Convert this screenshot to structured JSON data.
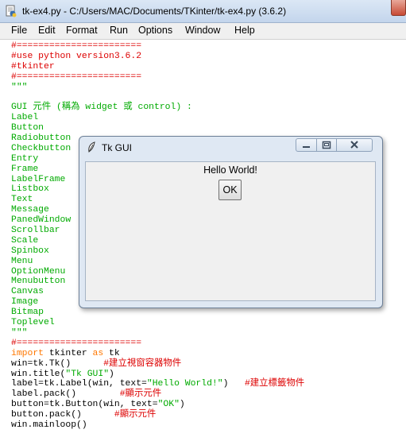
{
  "idle": {
    "title": "tk-ex4.py - C:/Users/MAC/Documents/TKinter/tk-ex4.py (3.6.2)",
    "menu": [
      "File",
      "Edit",
      "Format",
      "Run",
      "Options",
      "Window",
      "Help"
    ]
  },
  "code_lines": [
    [
      {
        "t": "#=======================",
        "c": "red"
      }
    ],
    [
      {
        "t": "#use python version3.6.2",
        "c": "red"
      }
    ],
    [
      {
        "t": "#tkinter",
        "c": "red"
      }
    ],
    [
      {
        "t": "#=======================",
        "c": "red"
      }
    ],
    [
      {
        "t": "\"\"\"",
        "c": "green"
      }
    ],
    [
      {
        "t": "",
        "c": "green"
      }
    ],
    [
      {
        "t": "GUI 元件 (稱為 widget 或 control) :",
        "c": "green"
      }
    ],
    [
      {
        "t": "Label",
        "c": "green"
      }
    ],
    [
      {
        "t": "Button",
        "c": "green"
      }
    ],
    [
      {
        "t": "Radiobutton",
        "c": "green"
      }
    ],
    [
      {
        "t": "Checkbutton",
        "c": "green"
      }
    ],
    [
      {
        "t": "Entry",
        "c": "green"
      }
    ],
    [
      {
        "t": "Frame",
        "c": "green"
      }
    ],
    [
      {
        "t": "LabelFrame",
        "c": "green"
      }
    ],
    [
      {
        "t": "Listbox",
        "c": "green"
      }
    ],
    [
      {
        "t": "Text",
        "c": "green"
      }
    ],
    [
      {
        "t": "Message",
        "c": "green"
      }
    ],
    [
      {
        "t": "PanedWindow",
        "c": "green"
      }
    ],
    [
      {
        "t": "Scrollbar",
        "c": "green"
      }
    ],
    [
      {
        "t": "Scale",
        "c": "green"
      }
    ],
    [
      {
        "t": "Spinbox",
        "c": "green"
      }
    ],
    [
      {
        "t": "Menu",
        "c": "green"
      }
    ],
    [
      {
        "t": "OptionMenu",
        "c": "green"
      }
    ],
    [
      {
        "t": "Menubutton",
        "c": "green"
      }
    ],
    [
      {
        "t": "Canvas",
        "c": "green"
      }
    ],
    [
      {
        "t": "Image",
        "c": "green"
      }
    ],
    [
      {
        "t": "Bitmap",
        "c": "green"
      }
    ],
    [
      {
        "t": "Toplevel",
        "c": "green"
      }
    ],
    [
      {
        "t": "\"\"\"",
        "c": "green"
      }
    ],
    [
      {
        "t": "#=======================",
        "c": "red"
      }
    ],
    [
      {
        "t": "import",
        "c": "orange"
      },
      {
        "t": " tkinter ",
        "c": "black"
      },
      {
        "t": "as",
        "c": "orange"
      },
      {
        "t": " tk",
        "c": "black"
      }
    ],
    [
      {
        "t": "win=tk.Tk()      ",
        "c": "black"
      },
      {
        "t": "#建立視窗容器物件",
        "c": "red"
      }
    ],
    [
      {
        "t": "win.title(",
        "c": "black"
      },
      {
        "t": "\"Tk GUI\"",
        "c": "green"
      },
      {
        "t": ")",
        "c": "black"
      }
    ],
    [
      {
        "t": "label=tk.Label(win, text=",
        "c": "black"
      },
      {
        "t": "\"Hello World!\"",
        "c": "green"
      },
      {
        "t": ")   ",
        "c": "black"
      },
      {
        "t": "#建立標籤物件",
        "c": "red"
      }
    ],
    [
      {
        "t": "label.pack()        ",
        "c": "black"
      },
      {
        "t": "#顯示元件",
        "c": "red"
      }
    ],
    [
      {
        "t": "button=tk.Button(win, text=",
        "c": "black"
      },
      {
        "t": "\"OK\"",
        "c": "green"
      },
      {
        "t": ")",
        "c": "black"
      }
    ],
    [
      {
        "t": "button.pack()      ",
        "c": "black"
      },
      {
        "t": "#顯示元件",
        "c": "red"
      }
    ],
    [
      {
        "t": "win.mainloop()",
        "c": "black"
      }
    ]
  ],
  "tk": {
    "title": "Tk GUI",
    "label_text": "Hello World!",
    "button_text": "OK"
  }
}
